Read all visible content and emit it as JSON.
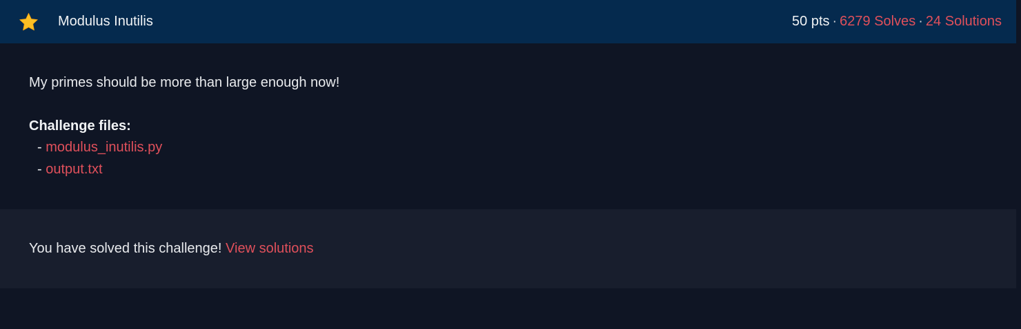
{
  "challenge": {
    "title": "Modulus Inutilis",
    "points": "50 pts",
    "separator": "·",
    "solves": "6279 Solves",
    "solutions": "24 Solutions",
    "icon": "star-icon",
    "icon_color": "#fbbf24"
  },
  "description": {
    "text": "My primes should be more than large enough now!",
    "files_heading": "Challenge files:",
    "file_prefix": "- ",
    "files": [
      "modulus_inutilis.py",
      "output.txt"
    ]
  },
  "solved": {
    "message": "You have solved this challenge!",
    "link": "View solutions"
  },
  "colors": {
    "header_bg": "#052a4e",
    "body_bg": "#0f1524",
    "solved_bg": "#181e2d",
    "link": "#e0505b"
  }
}
